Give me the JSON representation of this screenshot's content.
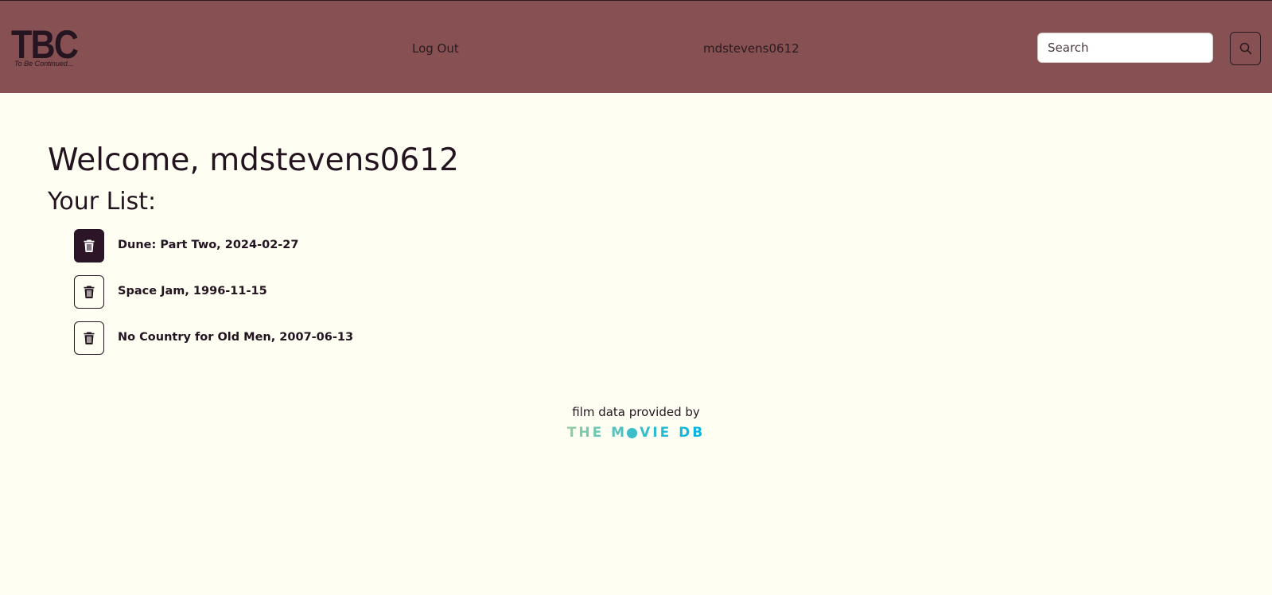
{
  "navbar": {
    "brand": {
      "main": "TBC",
      "tagline": "To Be Continued..."
    },
    "logout_label": "Log Out",
    "username": "mdstevens0612",
    "search": {
      "placeholder": "Search",
      "value": ""
    },
    "search_icon": "search-icon",
    "colors": {
      "background": "#875153",
      "text": "#2a1a1f"
    }
  },
  "main": {
    "welcome": "Welcome, mdstevens0612",
    "list_heading": "Your List:",
    "items": [
      {
        "label": "Dune: Part Two, 2024-02-27",
        "icon": "trash-icon",
        "active": true
      },
      {
        "label": "Space Jam, 1996-11-15",
        "icon": "trash-icon",
        "active": false
      },
      {
        "label": "No Country for Old Men, 2007-06-13",
        "icon": "trash-icon",
        "active": false
      }
    ],
    "colors": {
      "background": "#fefef2",
      "text": "#231420",
      "active_button": "#2b1526"
    }
  },
  "attribution": {
    "text": "film data provided by",
    "logo": {
      "part1": "THE M",
      "part2": "VIE DB"
    },
    "colors": {
      "start": "#90cea1",
      "end": "#01b4e4"
    }
  }
}
